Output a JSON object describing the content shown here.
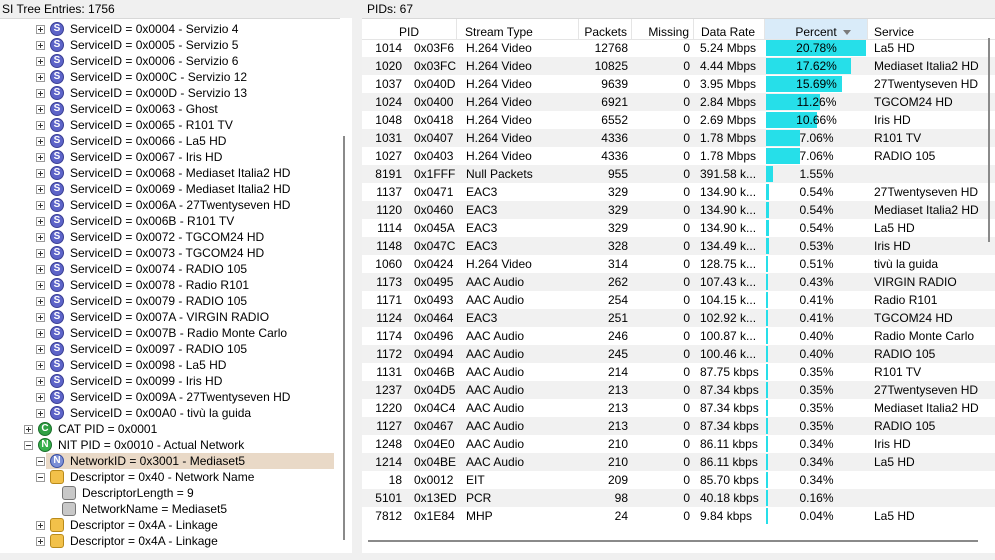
{
  "left_panel": {
    "title": "SI Tree Entries: 1756",
    "tree": [
      {
        "indent": 1,
        "exp": "plus",
        "icon": "S",
        "label": "ServiceID = 0x0004 - Servizio 4"
      },
      {
        "indent": 1,
        "exp": "plus",
        "icon": "S",
        "label": "ServiceID = 0x0005 - Servizio 5"
      },
      {
        "indent": 1,
        "exp": "plus",
        "icon": "S",
        "label": "ServiceID = 0x0006 - Servizio 6"
      },
      {
        "indent": 1,
        "exp": "plus",
        "icon": "S",
        "label": "ServiceID = 0x000C - Servizio 12"
      },
      {
        "indent": 1,
        "exp": "plus",
        "icon": "S",
        "label": "ServiceID = 0x000D - Servizio 13"
      },
      {
        "indent": 1,
        "exp": "plus",
        "icon": "S",
        "label": "ServiceID = 0x0063 - Ghost"
      },
      {
        "indent": 1,
        "exp": "plus",
        "icon": "S",
        "label": "ServiceID = 0x0065 - R101 TV"
      },
      {
        "indent": 1,
        "exp": "plus",
        "icon": "S",
        "label": "ServiceID = 0x0066 - La5 HD"
      },
      {
        "indent": 1,
        "exp": "plus",
        "icon": "S",
        "label": "ServiceID = 0x0067 - Iris HD"
      },
      {
        "indent": 1,
        "exp": "plus",
        "icon": "S",
        "label": "ServiceID = 0x0068 - Mediaset Italia2 HD"
      },
      {
        "indent": 1,
        "exp": "plus",
        "icon": "S",
        "label": "ServiceID = 0x0069 - Mediaset Italia2 HD"
      },
      {
        "indent": 1,
        "exp": "plus",
        "icon": "S",
        "label": "ServiceID = 0x006A - 27Twentyseven HD"
      },
      {
        "indent": 1,
        "exp": "plus",
        "icon": "S",
        "label": "ServiceID = 0x006B - R101 TV"
      },
      {
        "indent": 1,
        "exp": "plus",
        "icon": "S",
        "label": "ServiceID = 0x0072 - TGCOM24 HD"
      },
      {
        "indent": 1,
        "exp": "plus",
        "icon": "S",
        "label": "ServiceID = 0x0073 - TGCOM24 HD"
      },
      {
        "indent": 1,
        "exp": "plus",
        "icon": "S",
        "label": "ServiceID = 0x0074 - RADIO 105"
      },
      {
        "indent": 1,
        "exp": "plus",
        "icon": "S",
        "label": "ServiceID = 0x0078 - Radio R101"
      },
      {
        "indent": 1,
        "exp": "plus",
        "icon": "S",
        "label": "ServiceID = 0x0079 - RADIO 105"
      },
      {
        "indent": 1,
        "exp": "plus",
        "icon": "S",
        "label": "ServiceID = 0x007A - VIRGIN RADIO"
      },
      {
        "indent": 1,
        "exp": "plus",
        "icon": "S",
        "label": "ServiceID = 0x007B - Radio Monte Carlo"
      },
      {
        "indent": 1,
        "exp": "plus",
        "icon": "S",
        "label": "ServiceID = 0x0097 - RADIO 105"
      },
      {
        "indent": 1,
        "exp": "plus",
        "icon": "S",
        "label": "ServiceID = 0x0098 - La5 HD"
      },
      {
        "indent": 1,
        "exp": "plus",
        "icon": "S",
        "label": "ServiceID = 0x0099 - Iris HD"
      },
      {
        "indent": 1,
        "exp": "plus",
        "icon": "S",
        "label": "ServiceID = 0x009A - 27Twentyseven HD"
      },
      {
        "indent": 1,
        "exp": "plus",
        "icon": "S",
        "label": "ServiceID = 0x00A0 - tivù la guida"
      },
      {
        "indent": 0,
        "exp": "plus",
        "icon": "C",
        "label": "CAT PID = 0x0001"
      },
      {
        "indent": 0,
        "exp": "minus",
        "icon": "N",
        "label": "NIT PID = 0x0010 - Actual Network"
      },
      {
        "indent": 1,
        "exp": "minus",
        "icon": "NN",
        "label": "NetworkID = 0x3001 - Mediaset5",
        "selected": true
      },
      {
        "indent": 1,
        "exp": "minus",
        "icon": "D",
        "label": "Descriptor = 0x40 - Network Name"
      },
      {
        "indent": 2,
        "exp": "none",
        "icon": "L",
        "label": "DescriptorLength = 9"
      },
      {
        "indent": 2,
        "exp": "none",
        "icon": "L",
        "label": "NetworkName = Mediaset5"
      },
      {
        "indent": 1,
        "exp": "plus",
        "icon": "D",
        "label": "Descriptor = 0x4A - Linkage"
      },
      {
        "indent": 1,
        "exp": "plus",
        "icon": "D",
        "label": "Descriptor = 0x4A - Linkage"
      }
    ]
  },
  "right_panel": {
    "title": "PIDs: 67",
    "columns": [
      "PID",
      "Stream Type",
      "Packets",
      "Missing",
      "Data Rate",
      "Percent",
      "Service"
    ],
    "sorted_column": "Percent",
    "bar_color": "#26dfe9",
    "rows": [
      {
        "pid_dec": "1014",
        "pid_hex": "0x03F6",
        "type": "H.264 Video",
        "packets": "12768",
        "missing": "0",
        "rate": "5.24 Mbps",
        "percent": "20.78%",
        "pct": 20.78,
        "service": "La5 HD"
      },
      {
        "pid_dec": "1020",
        "pid_hex": "0x03FC",
        "type": "H.264 Video",
        "packets": "10825",
        "missing": "0",
        "rate": "4.44 Mbps",
        "percent": "17.62%",
        "pct": 17.62,
        "service": "Mediaset Italia2 HD"
      },
      {
        "pid_dec": "1037",
        "pid_hex": "0x040D",
        "type": "H.264 Video",
        "packets": "9639",
        "missing": "0",
        "rate": "3.95 Mbps",
        "percent": "15.69%",
        "pct": 15.69,
        "service": "27Twentyseven HD"
      },
      {
        "pid_dec": "1024",
        "pid_hex": "0x0400",
        "type": "H.264 Video",
        "packets": "6921",
        "missing": "0",
        "rate": "2.84 Mbps",
        "percent": "11.26%",
        "pct": 11.26,
        "service": "TGCOM24 HD"
      },
      {
        "pid_dec": "1048",
        "pid_hex": "0x0418",
        "type": "H.264 Video",
        "packets": "6552",
        "missing": "0",
        "rate": "2.69 Mbps",
        "percent": "10.66%",
        "pct": 10.66,
        "service": "Iris HD"
      },
      {
        "pid_dec": "1031",
        "pid_hex": "0x0407",
        "type": "H.264 Video",
        "packets": "4336",
        "missing": "0",
        "rate": "1.78 Mbps",
        "percent": "7.06%",
        "pct": 7.06,
        "service": "R101 TV"
      },
      {
        "pid_dec": "1027",
        "pid_hex": "0x0403",
        "type": "H.264 Video",
        "packets": "4336",
        "missing": "0",
        "rate": "1.78 Mbps",
        "percent": "7.06%",
        "pct": 7.06,
        "service": "RADIO 105"
      },
      {
        "pid_dec": "8191",
        "pid_hex": "0x1FFF",
        "type": "Null Packets",
        "packets": "955",
        "missing": "0",
        "rate": "391.58 k...",
        "percent": "1.55%",
        "pct": 1.55,
        "service": ""
      },
      {
        "pid_dec": "1137",
        "pid_hex": "0x0471",
        "type": "EAC3",
        "packets": "329",
        "missing": "0",
        "rate": "134.90 k...",
        "percent": "0.54%",
        "pct": 0.54,
        "service": "27Twentyseven HD"
      },
      {
        "pid_dec": "1120",
        "pid_hex": "0x0460",
        "type": "EAC3",
        "packets": "329",
        "missing": "0",
        "rate": "134.90 k...",
        "percent": "0.54%",
        "pct": 0.54,
        "service": "Mediaset Italia2 HD"
      },
      {
        "pid_dec": "1114",
        "pid_hex": "0x045A",
        "type": "EAC3",
        "packets": "329",
        "missing": "0",
        "rate": "134.90 k...",
        "percent": "0.54%",
        "pct": 0.54,
        "service": "La5 HD"
      },
      {
        "pid_dec": "1148",
        "pid_hex": "0x047C",
        "type": "EAC3",
        "packets": "328",
        "missing": "0",
        "rate": "134.49 k...",
        "percent": "0.53%",
        "pct": 0.53,
        "service": "Iris HD"
      },
      {
        "pid_dec": "1060",
        "pid_hex": "0x0424",
        "type": "H.264 Video",
        "packets": "314",
        "missing": "0",
        "rate": "128.75 k...",
        "percent": "0.51%",
        "pct": 0.51,
        "service": "tivù la guida"
      },
      {
        "pid_dec": "1173",
        "pid_hex": "0x0495",
        "type": "AAC Audio",
        "packets": "262",
        "missing": "0",
        "rate": "107.43 k...",
        "percent": "0.43%",
        "pct": 0.43,
        "service": "VIRGIN RADIO"
      },
      {
        "pid_dec": "1171",
        "pid_hex": "0x0493",
        "type": "AAC Audio",
        "packets": "254",
        "missing": "0",
        "rate": "104.15 k...",
        "percent": "0.41%",
        "pct": 0.41,
        "service": "Radio R101"
      },
      {
        "pid_dec": "1124",
        "pid_hex": "0x0464",
        "type": "EAC3",
        "packets": "251",
        "missing": "0",
        "rate": "102.92 k...",
        "percent": "0.41%",
        "pct": 0.41,
        "service": "TGCOM24 HD"
      },
      {
        "pid_dec": "1174",
        "pid_hex": "0x0496",
        "type": "AAC Audio",
        "packets": "246",
        "missing": "0",
        "rate": "100.87 k...",
        "percent": "0.40%",
        "pct": 0.4,
        "service": "Radio Monte Carlo"
      },
      {
        "pid_dec": "1172",
        "pid_hex": "0x0494",
        "type": "AAC Audio",
        "packets": "245",
        "missing": "0",
        "rate": "100.46 k...",
        "percent": "0.40%",
        "pct": 0.4,
        "service": "RADIO 105"
      },
      {
        "pid_dec": "1131",
        "pid_hex": "0x046B",
        "type": "AAC Audio",
        "packets": "214",
        "missing": "0",
        "rate": "87.75 kbps",
        "percent": "0.35%",
        "pct": 0.35,
        "service": "R101 TV"
      },
      {
        "pid_dec": "1237",
        "pid_hex": "0x04D5",
        "type": "AAC Audio",
        "packets": "213",
        "missing": "0",
        "rate": "87.34 kbps",
        "percent": "0.35%",
        "pct": 0.35,
        "service": "27Twentyseven HD"
      },
      {
        "pid_dec": "1220",
        "pid_hex": "0x04C4",
        "type": "AAC Audio",
        "packets": "213",
        "missing": "0",
        "rate": "87.34 kbps",
        "percent": "0.35%",
        "pct": 0.35,
        "service": "Mediaset Italia2 HD"
      },
      {
        "pid_dec": "1127",
        "pid_hex": "0x0467",
        "type": "AAC Audio",
        "packets": "213",
        "missing": "0",
        "rate": "87.34 kbps",
        "percent": "0.35%",
        "pct": 0.35,
        "service": "RADIO 105"
      },
      {
        "pid_dec": "1248",
        "pid_hex": "0x04E0",
        "type": "AAC Audio",
        "packets": "210",
        "missing": "0",
        "rate": "86.11 kbps",
        "percent": "0.34%",
        "pct": 0.34,
        "service": "Iris HD"
      },
      {
        "pid_dec": "1214",
        "pid_hex": "0x04BE",
        "type": "AAC Audio",
        "packets": "210",
        "missing": "0",
        "rate": "86.11 kbps",
        "percent": "0.34%",
        "pct": 0.34,
        "service": "La5 HD"
      },
      {
        "pid_dec": "18",
        "pid_hex": "0x0012",
        "type": "EIT",
        "packets": "209",
        "missing": "0",
        "rate": "85.70 kbps",
        "percent": "0.34%",
        "pct": 0.34,
        "service": ""
      },
      {
        "pid_dec": "5101",
        "pid_hex": "0x13ED",
        "type": "PCR",
        "packets": "98",
        "missing": "0",
        "rate": "40.18 kbps",
        "percent": "0.16%",
        "pct": 0.16,
        "service": ""
      },
      {
        "pid_dec": "7812",
        "pid_hex": "0x1E84",
        "type": "MHP",
        "packets": "24",
        "missing": "0",
        "rate": "9.84 kbps",
        "percent": "0.04%",
        "pct": 0.04,
        "service": "La5 HD"
      }
    ]
  }
}
